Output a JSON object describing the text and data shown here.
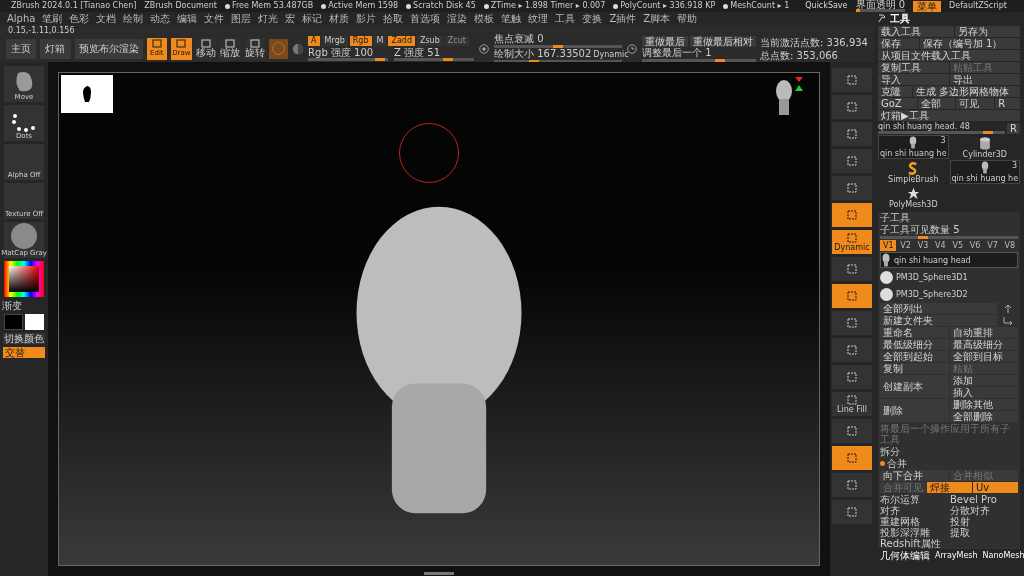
{
  "title_bar": {
    "app": "ZBrush 2024.0.1 [Tianao Chen]",
    "document": "ZBrush Document",
    "stats": [
      "Free Mem 53.487GB",
      "Active Mem 1598",
      "Scratch Disk 45",
      "ZTime ▸ 1.898 Timer ▸ 0.007",
      "PolyCount ▸ 336.918 KP",
      "MeshCount ▸ 1"
    ],
    "quicksave": "QuickSave",
    "transparency": {
      "label": "界面透明 0",
      "level": 0.1
    },
    "menu_button": "菜单",
    "script": "DefaultZScript"
  },
  "menu": [
    "Alpha",
    "笔刷",
    "色彩",
    "文档",
    "绘制",
    "动态",
    "编辑",
    "文件",
    "图层",
    "灯光",
    "宏",
    "标记",
    "材质",
    "影片",
    "拾取",
    "首选项",
    "渲染",
    "模板",
    "笔触",
    "纹理",
    "工具",
    "变换",
    "Z插件",
    "Z脚本",
    "帮助"
  ],
  "coords": "0.15,-1.11,0.156",
  "shelf": {
    "buttons": [
      "主页",
      "灯箱",
      "预览布尔渲染"
    ],
    "modes": [
      {
        "label": "Edit",
        "selected": true
      },
      {
        "label": "Draw",
        "selected": true
      },
      {
        "label": "移动",
        "selected": false
      },
      {
        "label": "缩放",
        "selected": false
      },
      {
        "label": "旋转",
        "selected": false
      }
    ],
    "toggles": [
      {
        "label": "A",
        "on": true,
        "disabled": false
      },
      {
        "label": "Mrgb",
        "on": false,
        "disabled": false
      },
      {
        "label": "Rgb",
        "on": true,
        "disabled": false
      },
      {
        "label": "M",
        "on": false,
        "disabled": false
      },
      {
        "label": "Zadd",
        "on": true,
        "disabled": false
      },
      {
        "label": "Zsub",
        "on": false,
        "disabled": false
      },
      {
        "label": "Zcut",
        "on": false,
        "disabled": true
      }
    ],
    "strengths": [
      {
        "label": "Rgb 强度 100",
        "level": 0.95
      },
      {
        "label": "Z 强度 51",
        "level": 0.7
      }
    ],
    "focal": {
      "label": "焦点衰减 0",
      "level": 0.5
    },
    "draw_size": {
      "label": "绘制大小 167.33502",
      "level": 0.3
    },
    "dynamic": "Dynamic",
    "redo": [
      "重做最后",
      "重做最后相对"
    ],
    "adjust": {
      "label": "调整最后一个 1",
      "level": 0.7
    },
    "stats": [
      "当前激活点数: 336,934",
      "总点数: 353,066"
    ]
  },
  "left_panel": {
    "brush": "Move",
    "stroke": "Dots",
    "alpha": "Alpha Off",
    "texture": "Texture Off",
    "material": "MatCap Gray",
    "gradient": "渐变",
    "switch_color": "切换颜色",
    "alternate": {
      "label": "交替",
      "on": true
    }
  },
  "right_toolbar": [
    {
      "selected": false
    },
    {
      "selected": false
    },
    {
      "selected": false
    },
    {
      "selected": false
    },
    {
      "selected": false
    },
    {
      "selected": true
    },
    {
      "selected": true,
      "label": "Dynamic"
    },
    {
      "selected": false
    },
    {
      "selected": true
    },
    {
      "selected": false
    },
    {
      "selected": false
    },
    {
      "selected": false
    },
    {
      "selected": false,
      "label": "Line Fill"
    },
    {
      "selected": false
    },
    {
      "selected": true
    },
    {
      "selected": false
    },
    {
      "selected": false
    }
  ],
  "tool_panel": {
    "title": "工具",
    "button_rows": [
      [
        {
          "label": "载入工具",
          "disabled": false
        },
        {
          "label": "另存为",
          "disabled": false
        }
      ],
      [
        {
          "label": "保存",
          "disabled": false
        },
        {
          "label": "保存（编号加 1）",
          "disabled": false
        }
      ],
      [
        {
          "label": "从项目文件载入工具",
          "disabled": false
        }
      ],
      [
        {
          "label": "复制工具",
          "disabled": false
        },
        {
          "label": "粘贴工具",
          "disabled": true
        }
      ],
      [
        {
          "label": "导入",
          "disabled": false
        },
        {
          "label": "导出",
          "disabled": false
        }
      ],
      [
        {
          "label": "克隆",
          "disabled": false
        },
        {
          "label": "生成 多边形网格物体",
          "disabled": false
        }
      ],
      [
        {
          "label": "GoZ",
          "disabled": false
        },
        {
          "label": "全部",
          "disabled": false
        },
        {
          "label": "可见",
          "disabled": false
        },
        {
          "label": "R",
          "disabled": false
        }
      ],
      [
        {
          "label": "灯箱▶工具",
          "disabled": false
        }
      ]
    ],
    "tool_slider": {
      "label": "qin shi huang head. 48",
      "level": 0.9
    },
    "reset": "R",
    "thumbs": [
      {
        "label": "qin shi huang he",
        "count": "3",
        "kind": "head"
      },
      {
        "label": "Cylinder3D",
        "kind": "cylinder"
      },
      {
        "label": "SimpleBrush",
        "kind": "brush"
      },
      {
        "label": "qin shi huang he",
        "count": "3",
        "kind": "head"
      },
      {
        "label": "PolyMesh3D",
        "kind": "star"
      }
    ]
  },
  "subtool": {
    "title": "子工具",
    "visible": {
      "label": "子工具可见数量 5",
      "level": 0.3
    },
    "tabs": [
      {
        "label": "V1",
        "selected": true
      },
      {
        "label": "V2",
        "selected": false
      },
      {
        "label": "V3",
        "selected": false
      },
      {
        "label": "V4",
        "selected": false
      },
      {
        "label": "V5",
        "selected": false
      },
      {
        "label": "V6",
        "selected": false
      },
      {
        "label": "V7",
        "selected": false
      },
      {
        "label": "V8",
        "selected": false
      }
    ],
    "items": [
      {
        "name": "qin shi huang head",
        "selected": true,
        "kind": "head"
      },
      {
        "name": "PM3D_Sphere3D1",
        "selected": false,
        "kind": "sphere"
      },
      {
        "name": "PM3D_Sphere3D2",
        "selected": false,
        "kind": "sphere"
      }
    ],
    "list_all": "全部列出",
    "new_folder": "新建文件夹",
    "pairs": [
      [
        {
          "label": "重命名",
          "disabled": false
        },
        {
          "label": "自动重排",
          "disabled": false
        }
      ],
      [
        {
          "label": "最低级细分",
          "disabled": false
        },
        {
          "label": "最高级细分",
          "disabled": false
        }
      ],
      [
        {
          "label": "全部到起始",
          "disabled": false
        },
        {
          "label": "全部到目标",
          "disabled": false
        }
      ],
      [
        {
          "label": "复制",
          "disabled": false
        },
        {
          "label": "粘贴",
          "disabled": true
        }
      ]
    ],
    "groups": [
      {
        "label": "创建副本",
        "options": [
          "添加",
          "插入"
        ]
      },
      {
        "label": "删除",
        "options": [
          "删除其他",
          "全部删除"
        ]
      }
    ],
    "apply_all": "将最后一个操作应用于所有子工具",
    "split": "拆分",
    "merge": "合并",
    "merge_buttons": [
      {
        "label": "向下合并",
        "disabled": false,
        "on": false
      },
      {
        "label": "合并相似",
        "disabled": true,
        "on": false
      },
      {
        "label": "合并可见",
        "disabled": true,
        "on": false
      },
      {
        "label": "焊接",
        "disabled": false,
        "on": true
      },
      {
        "label": "Uv",
        "disabled": false,
        "on": true
      }
    ],
    "sections": [
      "布尔运算",
      "Bevel Pro",
      "对齐",
      "分散对齐",
      "重建网格",
      "投射",
      "投影深浮雕",
      "提取",
      "Redshift属性"
    ]
  },
  "palettes": [
    "几何体编辑",
    "ArrayMesh",
    "NanoMesh"
  ]
}
